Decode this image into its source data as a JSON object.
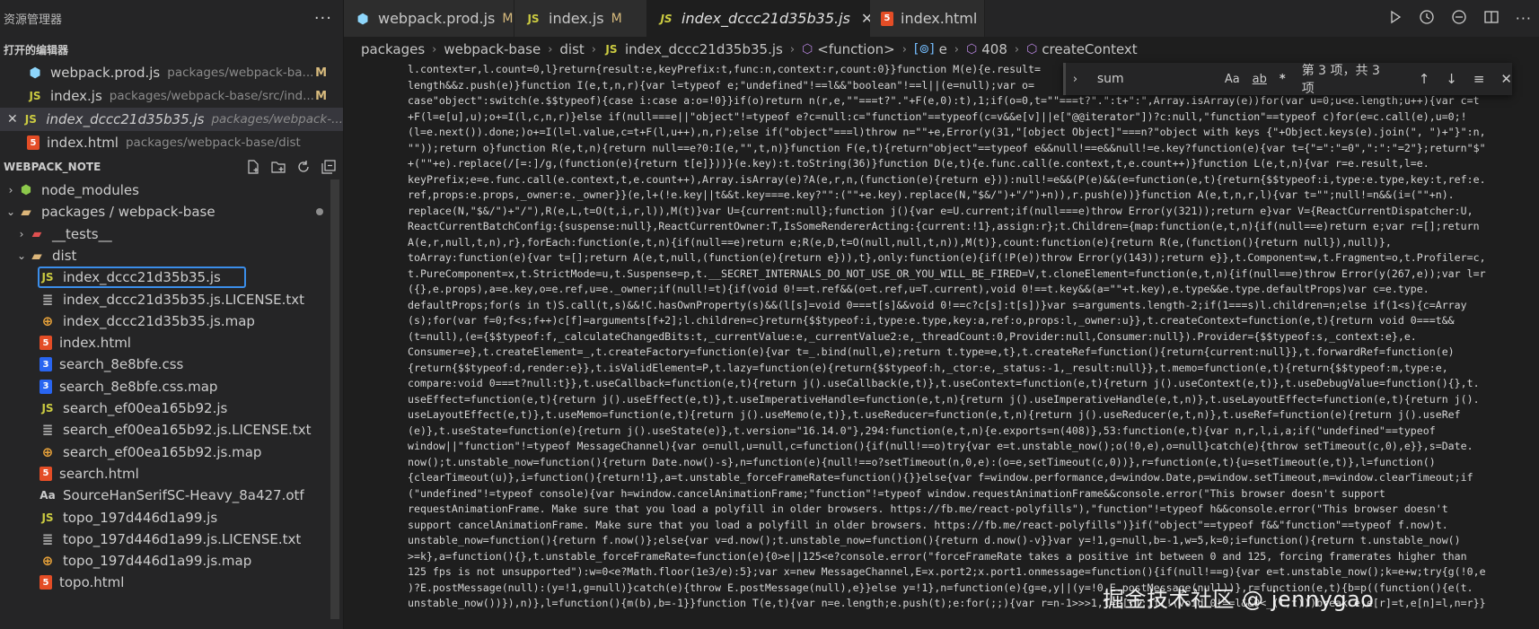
{
  "sidebar": {
    "title": "资源管理器",
    "more": "···",
    "open_editors_header": "打开的编辑器",
    "open_editors": [
      {
        "name": "webpack.prod.js",
        "path": "packages/webpack-ba...",
        "badge": "M",
        "icon": "webpack-icon",
        "close": ""
      },
      {
        "name": "index.js",
        "path": "packages/webpack-base/src/ind...",
        "badge": "M",
        "icon": "js-icon",
        "close": ""
      },
      {
        "name": "index_dccc21d35b35.js",
        "path": "packages/webpack-...",
        "badge": "",
        "icon": "js-icon",
        "close": "✕"
      },
      {
        "name": "index.html",
        "path": "packages/webpack-base/dist",
        "badge": "",
        "icon": "html-icon",
        "close": ""
      }
    ],
    "project_header": "WEBPACK_NOTE",
    "tree": [
      {
        "name": "node_modules",
        "kind": "folder",
        "indent": 0,
        "chevron": "›",
        "icon": "node-folder-icon"
      },
      {
        "name": "packages / webpack-base",
        "kind": "folder",
        "indent": 0,
        "chevron": "⌄",
        "icon": "folder-open-icon",
        "dot": true
      },
      {
        "name": "__tests__",
        "kind": "folder",
        "indent": 1,
        "chevron": "›",
        "icon": "test-folder-icon"
      },
      {
        "name": "dist",
        "kind": "folder",
        "indent": 1,
        "chevron": "⌄",
        "icon": "folder-open-icon"
      },
      {
        "name": "index_dccc21d35b35.js",
        "kind": "js",
        "indent": 2,
        "selected": true
      },
      {
        "name": "index_dccc21d35b35.js.LICENSE.txt",
        "kind": "txt",
        "indent": 2
      },
      {
        "name": "index_dccc21d35b35.js.map",
        "kind": "map",
        "indent": 2
      },
      {
        "name": "index.html",
        "kind": "html",
        "indent": 2
      },
      {
        "name": "search_8e8bfe.css",
        "kind": "css",
        "indent": 2
      },
      {
        "name": "search_8e8bfe.css.map",
        "kind": "cssmap",
        "indent": 2
      },
      {
        "name": "search_ef00ea165b92.js",
        "kind": "js",
        "indent": 2
      },
      {
        "name": "search_ef00ea165b92.js.LICENSE.txt",
        "kind": "txt",
        "indent": 2
      },
      {
        "name": "search_ef00ea165b92.js.map",
        "kind": "map",
        "indent": 2
      },
      {
        "name": "search.html",
        "kind": "html",
        "indent": 2
      },
      {
        "name": "SourceHanSerifSC-Heavy_8a427.otf",
        "kind": "font",
        "indent": 2
      },
      {
        "name": "topo_197d446d1a99.js",
        "kind": "js",
        "indent": 2
      },
      {
        "name": "topo_197d446d1a99.js.LICENSE.txt",
        "kind": "txt",
        "indent": 2
      },
      {
        "name": "topo_197d446d1a99.js.map",
        "kind": "map",
        "indent": 2
      },
      {
        "name": "topo.html",
        "kind": "html",
        "indent": 2
      }
    ]
  },
  "tabs": [
    {
      "label": "webpack.prod.js",
      "badge": "M",
      "icon": "webpack-icon",
      "active": false
    },
    {
      "label": "index.js",
      "badge": "M",
      "icon": "js-icon",
      "active": false
    },
    {
      "label": "index_dccc21d35b35.js",
      "badge": "",
      "icon": "js-icon",
      "active": true,
      "close": "✕"
    },
    {
      "label": "index.html",
      "badge": "",
      "icon": "html-icon",
      "active": false
    }
  ],
  "breadcrumb": [
    "packages",
    "webpack-base",
    "dist",
    "index_dccc21d35b35.js",
    "<function>",
    "e",
    "408",
    "createContext"
  ],
  "find": {
    "query": "sum",
    "options": [
      "Aa",
      "ab",
      "*"
    ],
    "result": "第 3 项，共 3 项"
  },
  "watermark": "掘金技术社区 @ jennygao",
  "code_lines": [
    "l.context=r,l.count=0,l}return{result:e,keyPrefix:t,func:n,context:r,count:0}}function M(e){e.result=",
    "length&&z.push(e)}function I(e,t,n,r){var l=typeof e;\"undefined\"!==l&&\"boolean\"!==l||(e=null);var o=",
    "case\"object\":switch(e.$$typeof){case i:case a:o=!0}}if(o)return n(r,e,\"\"===t?\".\"+F(e,0):t),1;if(o=0,t=\"\"===t?\".\":t+\":\",Array.isArray(e))for(var u=0;u<e.length;u++){var c=t",
    "+F(l=e[u],u);o+=I(l,c,n,r)}else if(null===e||\"object\"!=typeof e?c=null:c=\"function\"==typeof(c=v&&e[v]||e[\"@@iterator\"])?c:null,\"function\"==typeof c)for(e=c.call(e),u=0;!",
    "(l=e.next()).done;)o+=I(l=l.value,c=t+F(l,u++),n,r);else if(\"object\"===l)throw n=\"\"+e,Error(y(31,\"[object Object]\"===n?\"object with keys {\"+Object.keys(e).join(\", \")+\"}\":n,",
    "\"\"));return o}function R(e,t,n){return null==e?0:I(e,\"\",t,n)}function F(e,t){return\"object\"==typeof e&&null!==e&&null!=e.key?function(e){var t={\"=\":\"=0\",\":\":\"=2\"};return\"$\"",
    "+(\"\"+e).replace(/[=:]/g,(function(e){return t[e]}))}(e.key):t.toString(36)}function D(e,t){e.func.call(e.context,t,e.count++)}function L(e,t,n){var r=e.result,l=e.",
    "keyPrefix;e=e.func.call(e.context,t,e.count++),Array.isArray(e)?A(e,r,n,(function(e){return e})):null!=e&&(P(e)&&(e=function(e,t){return{$$typeof:i,type:e.type,key:t,ref:e.",
    "ref,props:e.props,_owner:e._owner}}(e,l+(!e.key||t&&t.key===e.key?\"\":(\"\"+e.key).replace(N,\"$&/\")+\"/\")+n)),r.push(e))}function A(e,t,n,r,l){var t=\"\";null!=n&&(i=(\"\"+n).",
    "replace(N,\"$&/\")+\"/\"),R(e,L,t=O(t,i,r,l)),M(t)}var U={current:null};function j(){var e=U.current;if(null===e)throw Error(y(321));return e}var V={ReactCurrentDispatcher:U,",
    "ReactCurrentBatchConfig:{suspense:null},ReactCurrentOwner:T,IsSomeRendererActing:{current:!1},assign:r};t.Children={map:function(e,t,n){if(null==e)return e;var r=[];return",
    "A(e,r,null,t,n),r},forEach:function(e,t,n){if(null==e)return e;R(e,D,t=O(null,null,t,n)),M(t)},count:function(e){return R(e,(function(){return null}),null)},",
    "toArray:function(e){var t=[];return A(e,t,null,(function(e){return e})),t},only:function(e){if(!P(e))throw Error(y(143));return e}},t.Component=w,t.Fragment=o,t.Profiler=c,",
    "t.PureComponent=x,t.StrictMode=u,t.Suspense=p,t.__SECRET_INTERNALS_DO_NOT_USE_OR_YOU_WILL_BE_FIRED=V,t.cloneElement=function(e,t,n){if(null==e)throw Error(y(267,e));var l=r",
    "({},e.props),a=e.key,o=e.ref,u=e._owner;if(null!=t){if(void 0!==t.ref&&(o=t.ref,u=T.current),void 0!==t.key&&(a=\"\"+t.key),e.type&&e.type.defaultProps)var c=e.type.",
    "defaultProps;for(s in t)S.call(t,s)&&!C.hasOwnProperty(s)&&(l[s]=void 0===t[s]&&void 0!==c?c[s]:t[s])}var s=arguments.length-2;if(1===s)l.children=n;else if(1<s){c=Array",
    "(s);for(var f=0;f<s;f++)c[f]=arguments[f+2];l.children=c}return{$$typeof:i,type:e.type,key:a,ref:o,props:l,_owner:u}},t.createContext=function(e,t){return void 0===t&&",
    "(t=null),(e={$$typeof:f,_calculateChangedBits:t,_currentValue:e,_currentValue2:e,_threadCount:0,Provider:null,Consumer:null}).Provider={$$typeof:s,_context:e},e.",
    "Consumer=e},t.createElement=_,t.createFactory=function(e){var t=_.bind(null,e);return t.type=e,t},t.createRef=function(){return{current:null}},t.forwardRef=function(e)",
    "{return{$$typeof:d,render:e}},t.isValidElement=P,t.lazy=function(e){return{$$typeof:h,_ctor:e,_status:-1,_result:null}},t.memo=function(e,t){return{$$typeof:m,type:e,",
    "compare:void 0===t?null:t}},t.useCallback=function(e,t){return j().useCallback(e,t)},t.useContext=function(e,t){return j().useContext(e,t)},t.useDebugValue=function(){},t.",
    "useEffect=function(e,t){return j().useEffect(e,t)},t.useImperativeHandle=function(e,t,n){return j().useImperativeHandle(e,t,n)},t.useLayoutEffect=function(e,t){return j().",
    "useLayoutEffect(e,t)},t.useMemo=function(e,t){return j().useMemo(e,t)},t.useReducer=function(e,t,n){return j().useReducer(e,t,n)},t.useRef=function(e){return j().useRef",
    "(e)},t.useState=function(e){return j().useState(e)},t.version=\"16.14.0\"},294:function(e,t,n){e.exports=n(408)},53:function(e,t){var n,r,l,i,a;if(\"undefined\"==typeof",
    "window||\"function\"!=typeof MessageChannel){var o=null,u=null,c=function(){if(null!==o)try{var e=t.unstable_now();o(!0,e),o=null}catch(e){throw setTimeout(c,0),e}},s=Date.",
    "now();t.unstable_now=function(){return Date.now()-s},n=function(e){null!==o?setTimeout(n,0,e):(o=e,setTimeout(c,0))},r=function(e,t){u=setTimeout(e,t)},l=function()",
    "{clearTimeout(u)},i=function(){return!1},a=t.unstable_forceFrameRate=function(){}}else{var f=window.performance,d=window.Date,p=window.setTimeout,m=window.clearTimeout;if",
    "(\"undefined\"!=typeof console){var h=window.cancelAnimationFrame;\"function\"!=typeof window.requestAnimationFrame&&console.error(\"This browser doesn't support",
    "requestAnimationFrame. Make sure that you load a polyfill in older browsers. https://fb.me/react-polyfills\"),\"function\"!=typeof h&&console.error(\"This browser doesn't",
    "support cancelAnimationFrame. Make sure that you load a polyfill in older browsers. https://fb.me/react-polyfills\")}if(\"object\"==typeof f&&\"function\"==typeof f.now)t.",
    "unstable_now=function(){return f.now()};else{var v=d.now();t.unstable_now=function(){return d.now()-v}}var y=!1,g=null,b=-1,w=5,k=0;i=function(){return t.unstable_now()",
    ">=k},a=function(){},t.unstable_forceFrameRate=function(e){0>e||125<e?console.error(\"forceFrameRate takes a positive int between 0 and 125, forcing framerates higher than",
    "125 fps is not unsupported\"):w=0<e?Math.floor(1e3/e):5};var x=new MessageChannel,E=x.port2;x.port1.onmessage=function(){if(null!==g){var e=t.unstable_now();k=e+w;try{g(!0,e",
    ")?E.postMessage(null):(y=!1,g=null)}catch(e){throw E.postMessage(null),e}}else y=!1},n=function(e){g=e,y||(y=!0,E.postMessage(null))},r=function(e,t){b=p((function(){e(t.",
    "unstable_now())}),n)},l=function(){m(b),b=-1}}function T(e,t){var n=e.length;e.push(t);e:for(;;){var r=n-1>>>1,l=e[r];if(!(void 0!==l&&0<_(l,t)))break e;e[r]=t,e[n]=l,n=r}}"
  ]
}
